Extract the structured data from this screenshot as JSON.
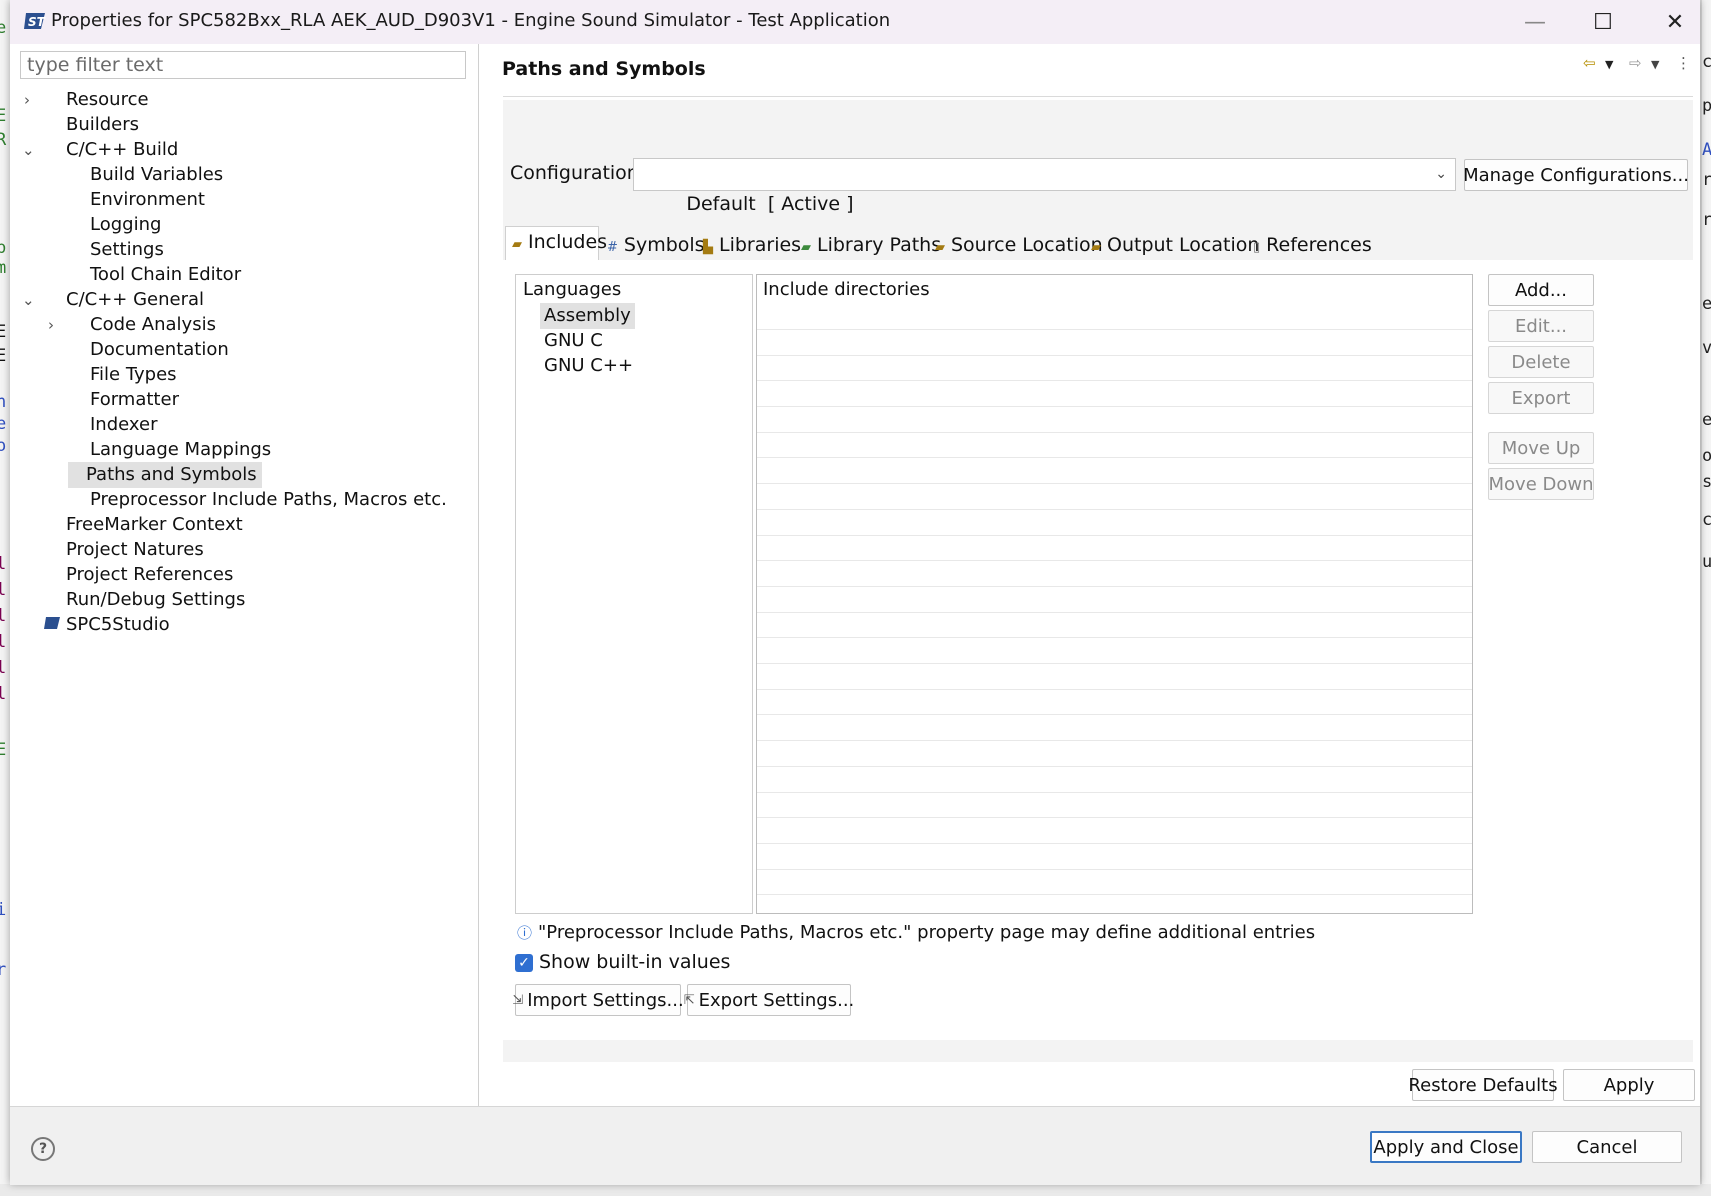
{
  "window": {
    "title": "Properties for SPC582Bxx_RLA AEK_AUD_D903V1 - Engine Sound Simulator - Test Application",
    "minimize": "—",
    "maximize": "☐",
    "close": "✕"
  },
  "filter": {
    "placeholder": "type filter text"
  },
  "tree": {
    "resource": "Resource",
    "builders": "Builders",
    "cpp_build": "C/C++ Build",
    "build_variables": "Build Variables",
    "environment": "Environment",
    "logging": "Logging",
    "settings": "Settings",
    "tool_chain_editor": "Tool Chain Editor",
    "cpp_general": "C/C++ General",
    "code_analysis": "Code Analysis",
    "documentation": "Documentation",
    "file_types": "File Types",
    "formatter": "Formatter",
    "indexer": "Indexer",
    "language_mappings": "Language Mappings",
    "paths_and_symbols": "Paths and Symbols",
    "preprocessor_include": "Preprocessor Include Paths, Macros etc.",
    "freemarker_context": "FreeMarker Context",
    "project_natures": "Project Natures",
    "project_references": "Project References",
    "run_debug_settings": "Run/Debug Settings",
    "spc5studio": "SPC5Studio"
  },
  "page": {
    "title": "Paths and Symbols",
    "configuration_label": "Configuration:",
    "configuration_value": "Default  [ Active ]",
    "manage_configurations": "Manage Configurations..."
  },
  "tabs": {
    "includes": "Includes",
    "symbols": "Symbols",
    "libraries": "Libraries",
    "library_paths": "Library Paths",
    "source_location": "Source Location",
    "output_location": "Output Location",
    "references": "References"
  },
  "languages": {
    "header": "Languages",
    "items": [
      "Assembly",
      "GNU C",
      "GNU C++"
    ]
  },
  "directories": {
    "header": "Include directories"
  },
  "side_buttons": {
    "add": "Add...",
    "edit": "Edit...",
    "delete": "Delete",
    "export": "Export",
    "move_up": "Move Up",
    "move_down": "Move Down"
  },
  "info_text": "\"Preprocessor Include Paths, Macros etc.\" property page may define additional entries",
  "show_builtin": {
    "label": "Show built-in values",
    "checked": true
  },
  "import_settings": "Import Settings...",
  "export_settings": "Export Settings...",
  "restore_defaults": "Restore Defaults",
  "apply": "Apply",
  "apply_and_close": "Apply and Close",
  "cancel": "Cancel",
  "colors": {
    "accent": "#2f6fd1",
    "selection": "#e1e1e1",
    "titlebar": "#f4eef6"
  }
}
